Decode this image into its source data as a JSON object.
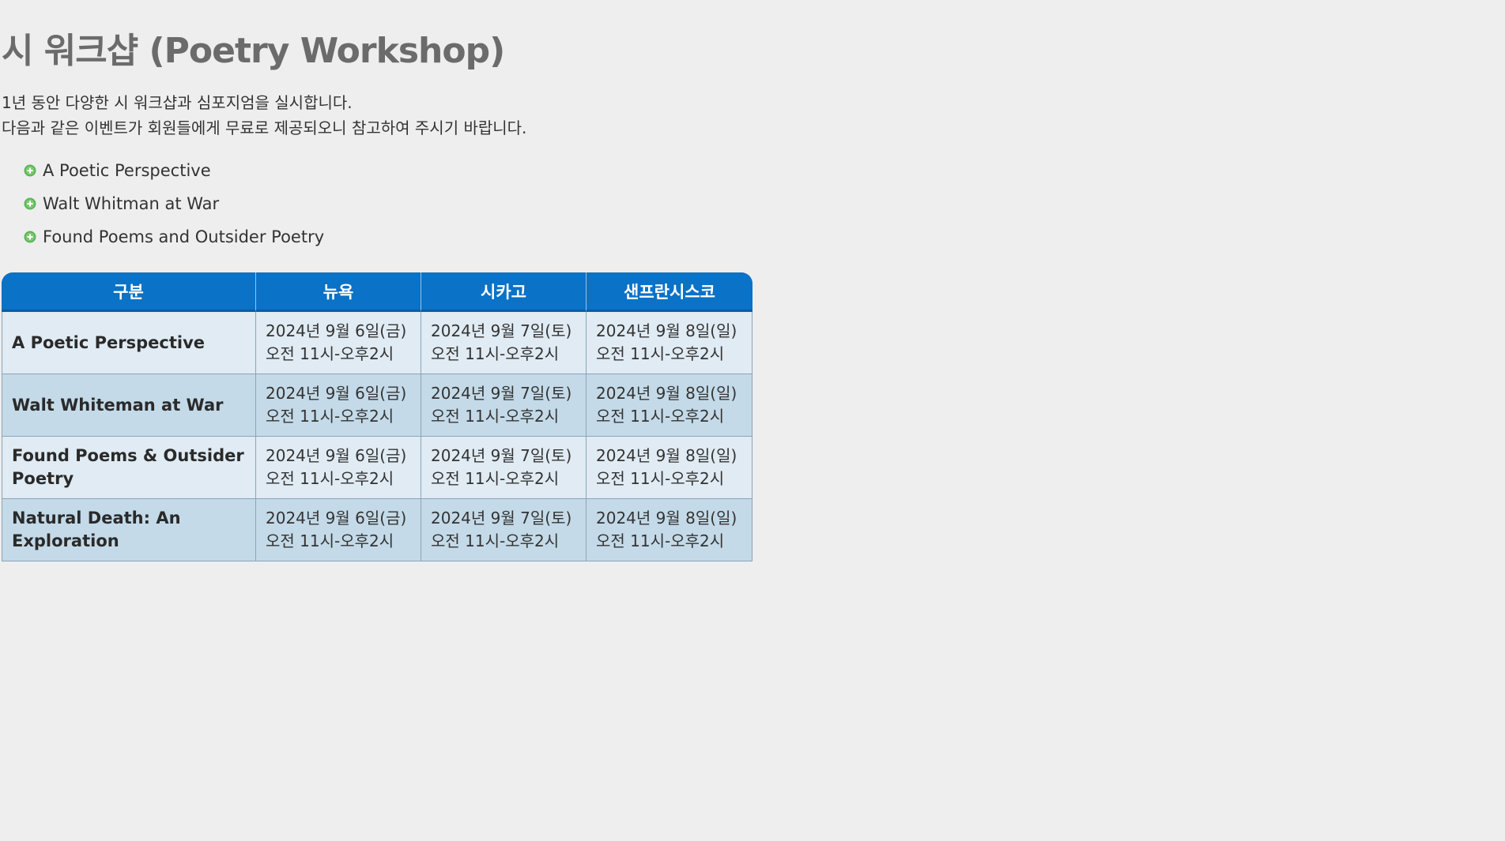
{
  "page": {
    "title": "시 워크샵 (Poetry Workshop)",
    "intro_line1": "1년 동안 다양한 시 워크샵과 심포지엄을 실시합니다.",
    "intro_line2": "다음과 같은 이벤트가 회원들에게 무료로 제공되오니 참고하여 주시기 바랍니다."
  },
  "events": [
    {
      "label": "A Poetic Perspective",
      "icon": "plus-circle-icon"
    },
    {
      "label": "Walt Whitman at War",
      "icon": "plus-circle-icon"
    },
    {
      "label": "Found Poems and Outsider Poetry",
      "icon": "plus-circle-icon"
    }
  ],
  "table": {
    "headers": [
      "구분",
      "뉴욕",
      "시카고",
      "샌프란시스코"
    ],
    "rows": [
      {
        "name": "A Poetic Perspective",
        "cells": [
          {
            "date": "2024년 9월 6일(금)",
            "time": "오전 11시-오후2시"
          },
          {
            "date": "2024년 9월 7일(토)",
            "time": "오전 11시-오후2시"
          },
          {
            "date": "2024년 9월 8일(일)",
            "time": "오전 11시-오후2시"
          }
        ]
      },
      {
        "name": "Walt Whiteman at War",
        "cells": [
          {
            "date": "2024년 9월 6일(금)",
            "time": "오전 11시-오후2시"
          },
          {
            "date": "2024년 9월 7일(토)",
            "time": "오전 11시-오후2시"
          },
          {
            "date": "2024년 9월 8일(일)",
            "time": "오전 11시-오후2시"
          }
        ]
      },
      {
        "name": "Found Poems & Outsider Poetry",
        "cells": [
          {
            "date": "2024년 9월 6일(금)",
            "time": "오전 11시-오후2시"
          },
          {
            "date": "2024년 9월 7일(토)",
            "time": "오전 11시-오후2시"
          },
          {
            "date": "2024년 9월 8일(일)",
            "time": "오전 11시-오후2시"
          }
        ]
      },
      {
        "name": "Natural Death: An Exploration",
        "cells": [
          {
            "date": "2024년 9월 6일(금)",
            "time": "오전 11시-오후2시"
          },
          {
            "date": "2024년 9월 7일(토)",
            "time": "오전 11시-오후2시"
          },
          {
            "date": "2024년 9월 8일(일)",
            "time": "오전 11시-오후2시"
          }
        ]
      }
    ]
  },
  "colors": {
    "background": "#eeeeee",
    "header_blue": "#0a72c7",
    "row_light": "#e0ebf3",
    "row_dark": "#c4dae8",
    "icon_green": "#5bb55b"
  }
}
